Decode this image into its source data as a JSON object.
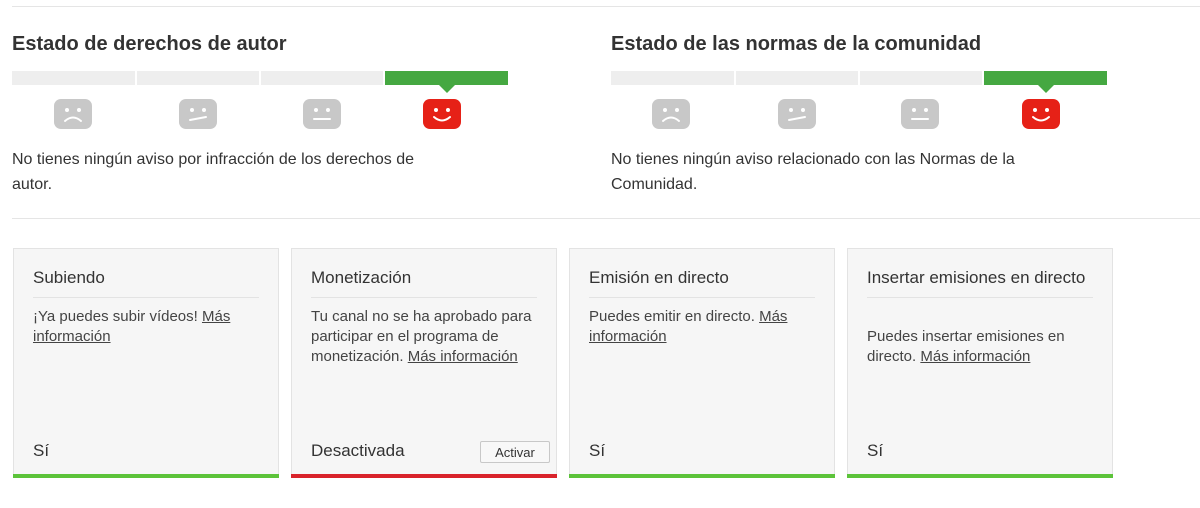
{
  "copyright": {
    "title": "Estado de derechos de autor",
    "message": "No tienes ningún aviso por infracción de los derechos de autor.",
    "level": 4,
    "levels_total": 4
  },
  "community": {
    "title": "Estado de las normas de la comunidad",
    "message": "No tienes ningún aviso relacionado con las Normas de la Comunidad.",
    "level": 4,
    "levels_total": 4
  },
  "colors": {
    "active_green": "#45a841",
    "face_gray": "#c8c8c8",
    "face_red": "#e62117",
    "status_green": "#5cc33a",
    "status_red": "#d9232b"
  },
  "cards": [
    {
      "title": "Subiendo",
      "desc_text": "¡Ya puedes subir vídeos! ",
      "link": "Más información",
      "status": "Sí",
      "state": "green"
    },
    {
      "title": "Monetización",
      "desc_text": "Tu canal no se ha aprobado para participar en el programa de monetización. ",
      "link": "Más información",
      "status": "Desactivada",
      "state": "red",
      "button": "Activar"
    },
    {
      "title": "Emisión en directo",
      "desc_text": "Puedes emitir en directo. ",
      "link": "Más información",
      "status": "Sí",
      "state": "green"
    },
    {
      "title": "Insertar emisiones en directo",
      "desc_text": "Puedes insertar emisiones en directo. ",
      "link": "Más información",
      "status": "Sí",
      "state": "green"
    }
  ]
}
